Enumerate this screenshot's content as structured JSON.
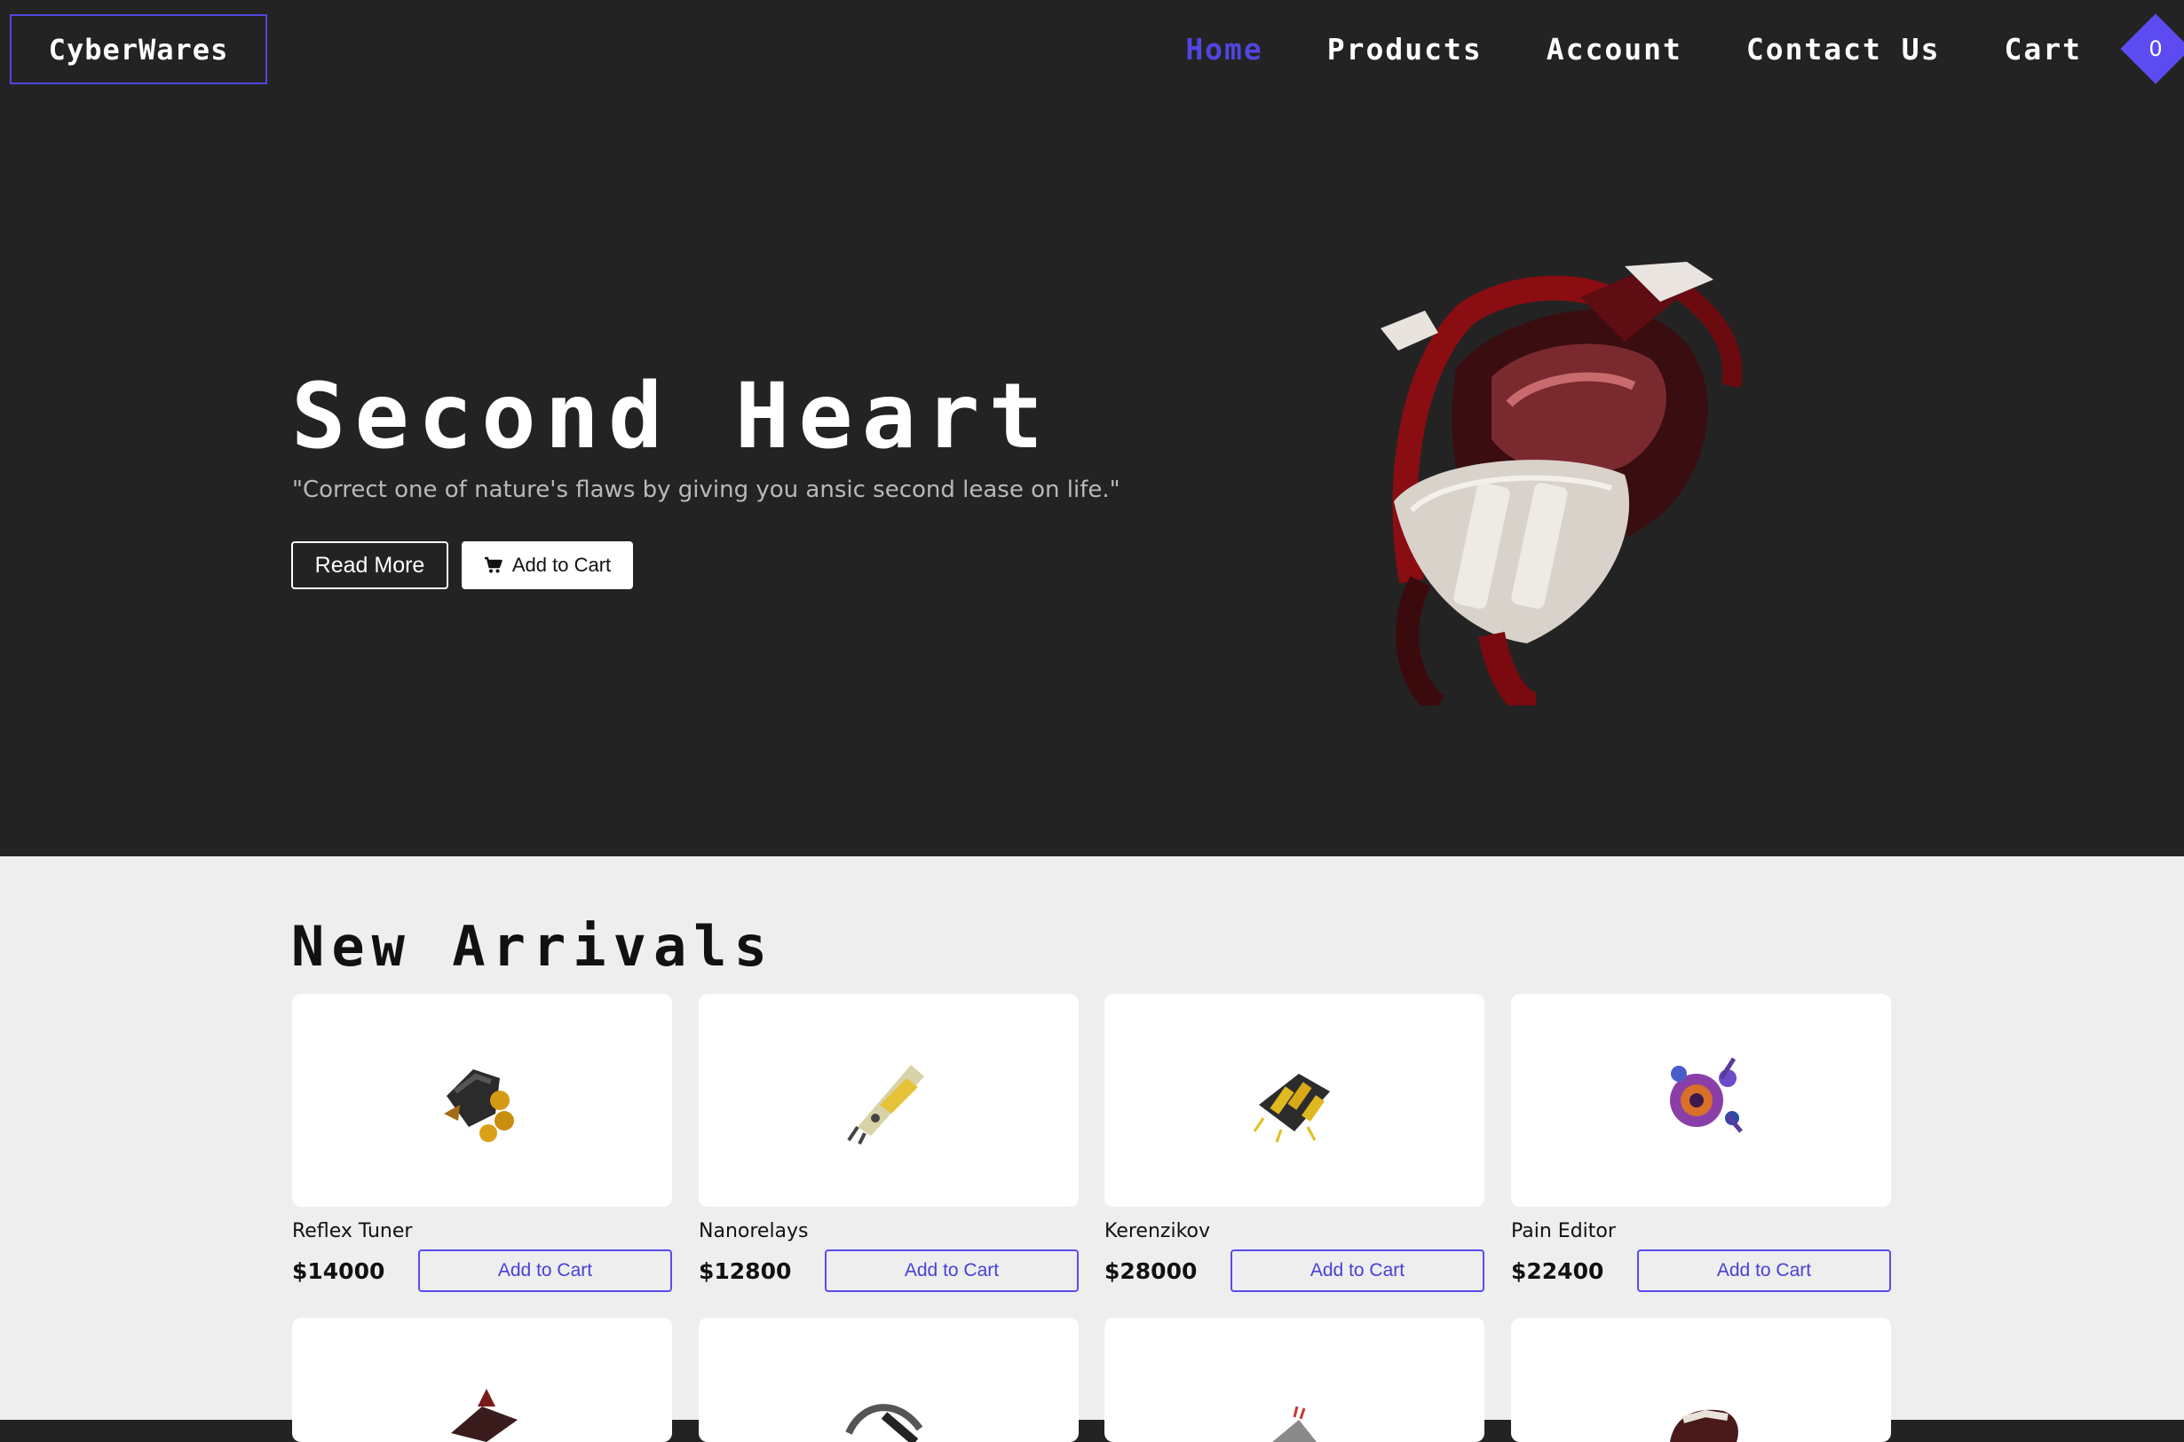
{
  "nav": {
    "logo": "CyberWares",
    "links": [
      "Home",
      "Products",
      "Account",
      "Contact Us",
      "Cart"
    ],
    "active": "Home",
    "cart_count": "0"
  },
  "hero": {
    "title": "Second Heart",
    "quote": "\"Correct one of nature's flaws by giving you ansic second lease on life.\"",
    "read_more": "Read More",
    "add_to_cart": "Add to Cart",
    "image": "cybernetic-heart-image"
  },
  "arrivals": {
    "title": "New Arrivals",
    "products": [
      {
        "name": "Reflex Tuner",
        "price": "$14000",
        "button": "Add to Cart",
        "image": "reflex-tuner-image"
      },
      {
        "name": "Nanorelays",
        "price": "$12800",
        "button": "Add to Cart",
        "image": "nanorelays-image"
      },
      {
        "name": "Kerenzikov",
        "price": "$28000",
        "button": "Add to Cart",
        "image": "kerenzikov-image"
      },
      {
        "name": "Pain Editor",
        "price": "$22400",
        "button": "Add to Cart",
        "image": "pain-editor-image"
      }
    ]
  },
  "colors": {
    "accent": "#5b4bf0",
    "dark_bg": "#232323",
    "light_bg": "#eeeeee"
  }
}
